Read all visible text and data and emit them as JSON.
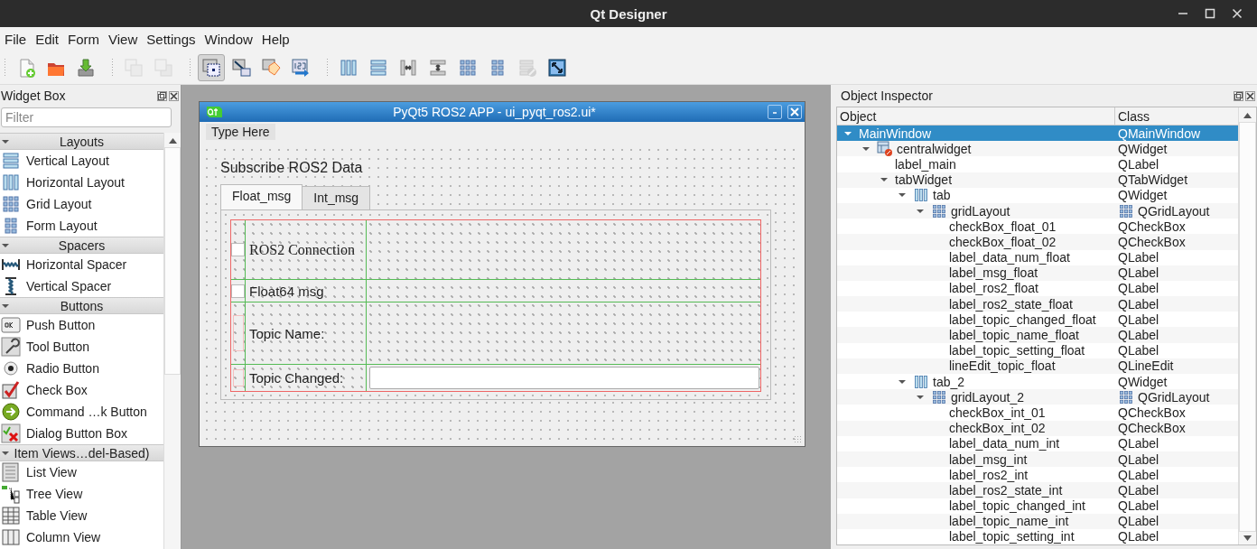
{
  "window": {
    "title": "Qt Designer"
  },
  "menu": [
    {
      "label": "File"
    },
    {
      "label": "Edit"
    },
    {
      "label": "Form"
    },
    {
      "label": "View"
    },
    {
      "label": "Settings"
    },
    {
      "label": "Window"
    },
    {
      "label": "Help"
    }
  ],
  "toolbar_groups": [
    {
      "buttons": [
        {
          "kind": "new",
          "selected": false,
          "disabled": false
        },
        {
          "kind": "open",
          "selected": false,
          "disabled": false
        },
        {
          "kind": "save",
          "selected": false,
          "disabled": false
        }
      ]
    },
    {
      "buttons": [
        {
          "kind": "front",
          "selected": false,
          "disabled": true
        },
        {
          "kind": "back",
          "selected": false,
          "disabled": true
        }
      ]
    },
    {
      "buttons": [
        {
          "kind": "edit-widgets",
          "selected": true,
          "disabled": false
        },
        {
          "kind": "edit-signals",
          "selected": false,
          "disabled": false
        },
        {
          "kind": "edit-buddies",
          "selected": false,
          "disabled": false
        },
        {
          "kind": "edit-taborder",
          "selected": false,
          "disabled": false
        }
      ]
    },
    {
      "buttons": [
        {
          "kind": "hlayout",
          "selected": false,
          "disabled": false
        },
        {
          "kind": "vlayout",
          "selected": false,
          "disabled": false
        },
        {
          "kind": "hsplit",
          "selected": false,
          "disabled": false
        },
        {
          "kind": "vsplit",
          "selected": false,
          "disabled": false
        },
        {
          "kind": "grid",
          "selected": false,
          "disabled": false
        },
        {
          "kind": "form",
          "selected": false,
          "disabled": false
        },
        {
          "kind": "break",
          "selected": false,
          "disabled": true
        },
        {
          "kind": "adjust",
          "selected": false,
          "disabled": false
        }
      ]
    }
  ],
  "widget_box": {
    "title": "Widget Box",
    "filter": {
      "placeholder": "Filter"
    },
    "categories": [
      {
        "label": "Layouts",
        "expanded": true,
        "items": [
          {
            "label": "Vertical Layout",
            "kind": "vlayout"
          },
          {
            "label": "Horizontal Layout",
            "kind": "hlayout"
          },
          {
            "label": "Grid Layout",
            "kind": "grid"
          },
          {
            "label": "Form Layout",
            "kind": "form"
          }
        ]
      },
      {
        "label": "Spacers",
        "expanded": true,
        "items": [
          {
            "label": "Horizontal Spacer",
            "kind": "hspacer"
          },
          {
            "label": "Vertical Spacer",
            "kind": "vspacer"
          }
        ]
      },
      {
        "label": "Buttons",
        "expanded": true,
        "items": [
          {
            "label": "Push Button",
            "kind": "push"
          },
          {
            "label": "Tool Button",
            "kind": "tool"
          },
          {
            "label": "Radio Button",
            "kind": "radio"
          },
          {
            "label": "Check Box",
            "kind": "check"
          },
          {
            "label": "Command …k Button",
            "kind": "command"
          },
          {
            "label": "Dialog Button Box",
            "kind": "dialog"
          }
        ]
      },
      {
        "label": "Item Views…del-Based)",
        "expanded": true,
        "items": [
          {
            "label": "List View",
            "kind": "list"
          },
          {
            "label": "Tree View",
            "kind": "tree"
          },
          {
            "label": "Table View",
            "kind": "table"
          },
          {
            "label": "Column View",
            "kind": "column"
          }
        ]
      }
    ]
  },
  "form_window": {
    "title": "PyQt5 ROS2 APP - ui_pyqt_ros2.ui*",
    "menubar": "Type Here",
    "heading": "Subscribe ROS2 Data",
    "tabs": [
      {
        "label": "Float_msg",
        "selected": true
      },
      {
        "label": "Int_msg",
        "selected": false
      }
    ],
    "grid": [
      {
        "kind": "checkbox",
        "label": "ROS2  Connection",
        "checked": false
      },
      {
        "kind": "checkbox",
        "label": "Float64 msg",
        "checked": false
      },
      {
        "kind": "label",
        "label": "Topic Name:"
      },
      {
        "kind": "field",
        "label": "Topic Changed:"
      }
    ]
  },
  "object_inspector": {
    "title": "Object Inspector",
    "columns": [
      "Object",
      "Class"
    ],
    "tree": [
      {
        "name": "MainWindow",
        "class": "QMainWindow",
        "selected": true,
        "expanded": true,
        "children": [
          {
            "name": "centralwidget",
            "class": "QWidget",
            "kind": "widget",
            "selected": false,
            "expanded": true,
            "children": [
              {
                "name": "label_main",
                "class": "QLabel",
                "selected": false
              },
              {
                "name": "tabWidget",
                "class": "QTabWidget",
                "selected": false,
                "expanded": true,
                "children": [
                  {
                    "name": "tab",
                    "class": "QWidget",
                    "kind": "hlayout",
                    "selected": false,
                    "expanded": true,
                    "children": [
                      {
                        "name": "gridLayout",
                        "class": "QGridLayout",
                        "kind": "grid",
                        "selected": false,
                        "expanded": true,
                        "children": [
                          {
                            "name": "checkBox_float_01",
                            "class": "QCheckBox",
                            "selected": false
                          },
                          {
                            "name": "checkBox_float_02",
                            "class": "QCheckBox",
                            "selected": false
                          },
                          {
                            "name": "label_data_num_float",
                            "class": "QLabel",
                            "selected": false
                          },
                          {
                            "name": "label_msg_float",
                            "class": "QLabel",
                            "selected": false
                          },
                          {
                            "name": "label_ros2_float",
                            "class": "QLabel",
                            "selected": false
                          },
                          {
                            "name": "label_ros2_state_float",
                            "class": "QLabel",
                            "selected": false
                          },
                          {
                            "name": "label_topic_changed_float",
                            "class": "QLabel",
                            "selected": false
                          },
                          {
                            "name": "label_topic_name_float",
                            "class": "QLabel",
                            "selected": false
                          },
                          {
                            "name": "label_topic_setting_float",
                            "class": "QLabel",
                            "selected": false
                          },
                          {
                            "name": "lineEdit_topic_float",
                            "class": "QLineEdit",
                            "selected": false
                          }
                        ]
                      }
                    ]
                  },
                  {
                    "name": "tab_2",
                    "class": "QWidget",
                    "kind": "hlayout",
                    "selected": false,
                    "expanded": true,
                    "children": [
                      {
                        "name": "gridLayout_2",
                        "class": "QGridLayout",
                        "kind": "grid",
                        "selected": false,
                        "expanded": true,
                        "children": [
                          {
                            "name": "checkBox_int_01",
                            "class": "QCheckBox",
                            "selected": false
                          },
                          {
                            "name": "checkBox_int_02",
                            "class": "QCheckBox",
                            "selected": false
                          },
                          {
                            "name": "label_data_num_int",
                            "class": "QLabel",
                            "selected": false
                          },
                          {
                            "name": "label_msg_int",
                            "class": "QLabel",
                            "selected": false
                          },
                          {
                            "name": "label_ros2_int",
                            "class": "QLabel",
                            "selected": false
                          },
                          {
                            "name": "label_ros2_state_int",
                            "class": "QLabel",
                            "selected": false
                          },
                          {
                            "name": "label_topic_changed_int",
                            "class": "QLabel",
                            "selected": false
                          },
                          {
                            "name": "label_topic_name_int",
                            "class": "QLabel",
                            "selected": false
                          },
                          {
                            "name": "label_topic_setting_int",
                            "class": "QLabel",
                            "selected": false
                          }
                        ]
                      }
                    ]
                  }
                ]
              }
            ]
          }
        ]
      }
    ]
  }
}
